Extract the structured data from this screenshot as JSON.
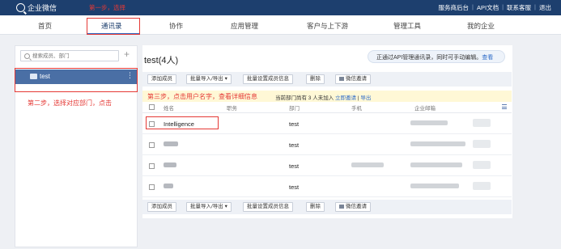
{
  "app": {
    "brand": "企业微信",
    "step1": "第一步，选择",
    "top_links": [
      "服务商后台",
      "API文档",
      "联系客服",
      "退出"
    ]
  },
  "nav": {
    "items": [
      "首页",
      "通讯录",
      "协作",
      "应用管理",
      "客户与上下游",
      "管理工具",
      "我的企业"
    ],
    "active_index": 1
  },
  "sidebar": {
    "search_placeholder": "搜索成员、部门",
    "department": "test",
    "step2": "第二步，选择对应部门，点击"
  },
  "main": {
    "title": "test(4人)",
    "api_banner_text": "正通过API管理通讯录，同时可手动编辑。",
    "api_banner_link": "查看",
    "toolbar": {
      "add_member": "添加成员",
      "import_export": "批量导入/导出 ▾",
      "batch_set": "批量设置成员信息",
      "delete": "删除",
      "invite": "微信邀请"
    },
    "step3": "第三步，点击用户名字，查看详细信息",
    "notice_text": "当前部门尚有 3 人未加入",
    "notice_link": "立即邀请",
    "notice_sep": "|",
    "notice_action": "导出",
    "columns": [
      "姓名",
      "职务",
      "部门",
      "手机",
      "企业邮箱"
    ],
    "rows": [
      {
        "name": "Intelligence",
        "department": "test"
      },
      {
        "name": "",
        "department": "test"
      },
      {
        "name": "",
        "department": "test"
      },
      {
        "name": "",
        "department": "test"
      }
    ]
  },
  "colors": {
    "topbar": "#1d3f6e",
    "accent": "#2f6cc8",
    "annotation_red": "#e53935",
    "selected_dept": "#4a6fa5"
  }
}
